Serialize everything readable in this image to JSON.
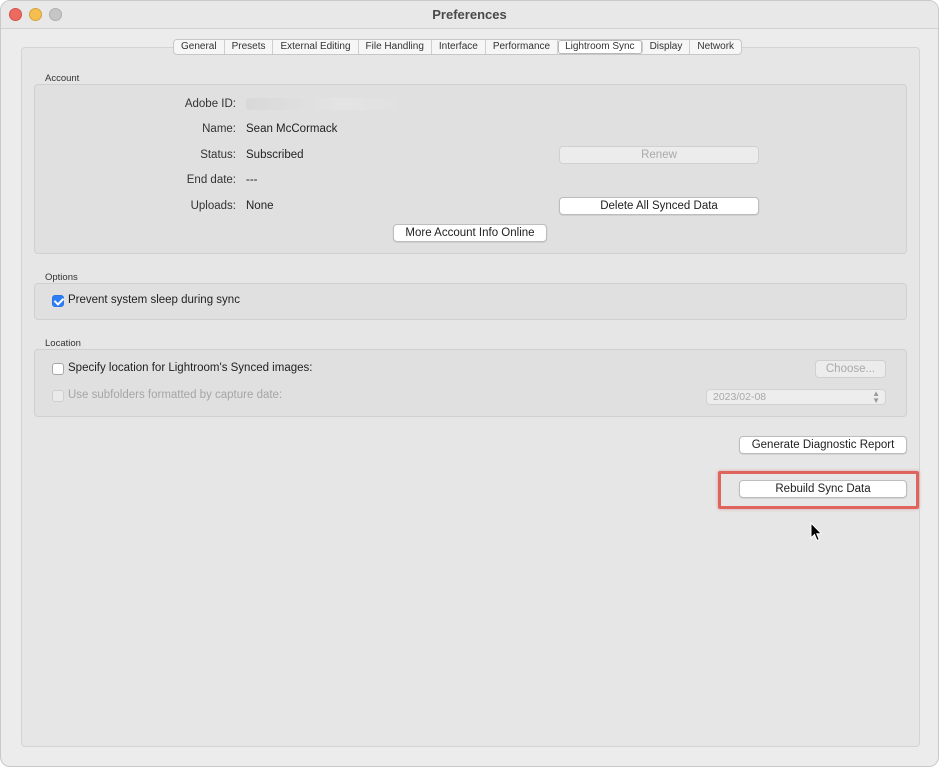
{
  "window": {
    "title": "Preferences"
  },
  "tabs": [
    {
      "label": "General",
      "active": false
    },
    {
      "label": "Presets",
      "active": false
    },
    {
      "label": "External Editing",
      "active": false
    },
    {
      "label": "File Handling",
      "active": false
    },
    {
      "label": "Interface",
      "active": false
    },
    {
      "label": "Performance",
      "active": false
    },
    {
      "label": "Lightroom Sync",
      "active": true
    },
    {
      "label": "Display",
      "active": false
    },
    {
      "label": "Network",
      "active": false
    }
  ],
  "account": {
    "section_label": "Account",
    "adobe_id_label": "Adobe ID:",
    "adobe_id_value": "",
    "name_label": "Name:",
    "name_value": "Sean McCormack",
    "status_label": "Status:",
    "status_value": "Subscribed",
    "end_date_label": "End date:",
    "end_date_value": "---",
    "uploads_label": "Uploads:",
    "uploads_value": "None",
    "renew_button": "Renew",
    "delete_button": "Delete All Synced Data",
    "more_info_button": "More Account Info Online"
  },
  "options": {
    "section_label": "Options",
    "prevent_sleep_label": "Prevent system sleep during sync",
    "prevent_sleep_checked": true
  },
  "location": {
    "section_label": "Location",
    "specify_location_label": "Specify location for Lightroom's Synced images:",
    "specify_location_checked": false,
    "choose_button": "Choose...",
    "subfolders_label": "Use subfolders formatted by capture date:",
    "subfolders_checked": false,
    "date_format_value": "2023/02-08"
  },
  "actions": {
    "diagnostic_button": "Generate Diagnostic Report",
    "rebuild_button": "Rebuild Sync Data"
  },
  "colors": {
    "highlight": "#e0645e",
    "checkbox_accent": "#2d7df6"
  }
}
